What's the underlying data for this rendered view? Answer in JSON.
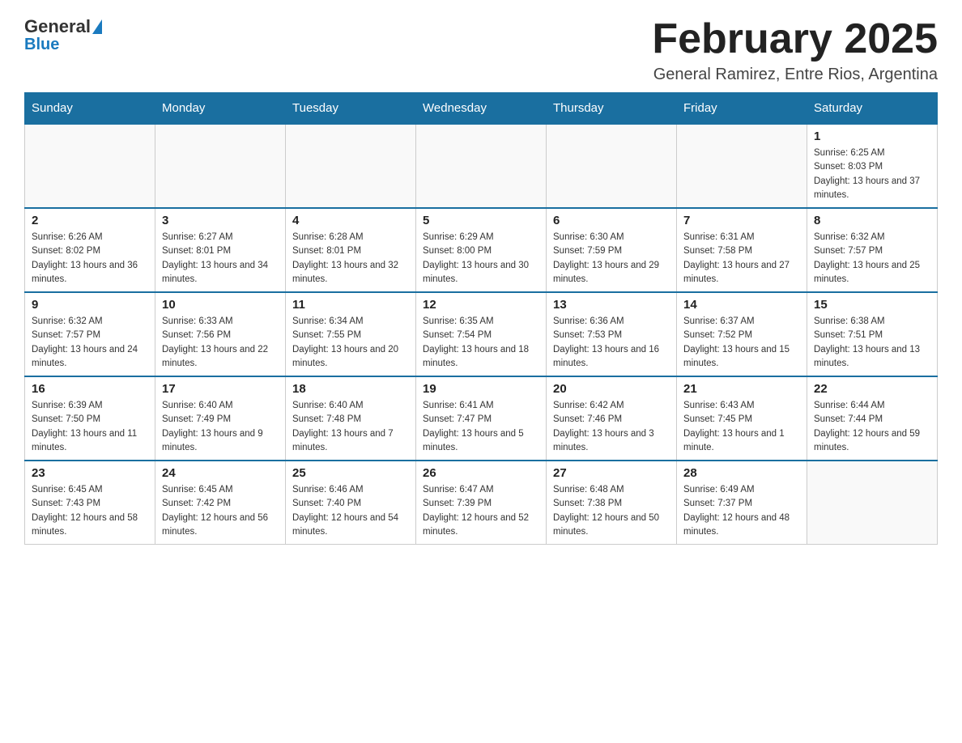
{
  "header": {
    "logo_general": "General",
    "logo_blue": "Blue",
    "month_title": "February 2025",
    "location": "General Ramirez, Entre Rios, Argentina"
  },
  "days_of_week": [
    "Sunday",
    "Monday",
    "Tuesday",
    "Wednesday",
    "Thursday",
    "Friday",
    "Saturday"
  ],
  "weeks": [
    [
      {
        "day": "",
        "info": ""
      },
      {
        "day": "",
        "info": ""
      },
      {
        "day": "",
        "info": ""
      },
      {
        "day": "",
        "info": ""
      },
      {
        "day": "",
        "info": ""
      },
      {
        "day": "",
        "info": ""
      },
      {
        "day": "1",
        "info": "Sunrise: 6:25 AM\nSunset: 8:03 PM\nDaylight: 13 hours and 37 minutes."
      }
    ],
    [
      {
        "day": "2",
        "info": "Sunrise: 6:26 AM\nSunset: 8:02 PM\nDaylight: 13 hours and 36 minutes."
      },
      {
        "day": "3",
        "info": "Sunrise: 6:27 AM\nSunset: 8:01 PM\nDaylight: 13 hours and 34 minutes."
      },
      {
        "day": "4",
        "info": "Sunrise: 6:28 AM\nSunset: 8:01 PM\nDaylight: 13 hours and 32 minutes."
      },
      {
        "day": "5",
        "info": "Sunrise: 6:29 AM\nSunset: 8:00 PM\nDaylight: 13 hours and 30 minutes."
      },
      {
        "day": "6",
        "info": "Sunrise: 6:30 AM\nSunset: 7:59 PM\nDaylight: 13 hours and 29 minutes."
      },
      {
        "day": "7",
        "info": "Sunrise: 6:31 AM\nSunset: 7:58 PM\nDaylight: 13 hours and 27 minutes."
      },
      {
        "day": "8",
        "info": "Sunrise: 6:32 AM\nSunset: 7:57 PM\nDaylight: 13 hours and 25 minutes."
      }
    ],
    [
      {
        "day": "9",
        "info": "Sunrise: 6:32 AM\nSunset: 7:57 PM\nDaylight: 13 hours and 24 minutes."
      },
      {
        "day": "10",
        "info": "Sunrise: 6:33 AM\nSunset: 7:56 PM\nDaylight: 13 hours and 22 minutes."
      },
      {
        "day": "11",
        "info": "Sunrise: 6:34 AM\nSunset: 7:55 PM\nDaylight: 13 hours and 20 minutes."
      },
      {
        "day": "12",
        "info": "Sunrise: 6:35 AM\nSunset: 7:54 PM\nDaylight: 13 hours and 18 minutes."
      },
      {
        "day": "13",
        "info": "Sunrise: 6:36 AM\nSunset: 7:53 PM\nDaylight: 13 hours and 16 minutes."
      },
      {
        "day": "14",
        "info": "Sunrise: 6:37 AM\nSunset: 7:52 PM\nDaylight: 13 hours and 15 minutes."
      },
      {
        "day": "15",
        "info": "Sunrise: 6:38 AM\nSunset: 7:51 PM\nDaylight: 13 hours and 13 minutes."
      }
    ],
    [
      {
        "day": "16",
        "info": "Sunrise: 6:39 AM\nSunset: 7:50 PM\nDaylight: 13 hours and 11 minutes."
      },
      {
        "day": "17",
        "info": "Sunrise: 6:40 AM\nSunset: 7:49 PM\nDaylight: 13 hours and 9 minutes."
      },
      {
        "day": "18",
        "info": "Sunrise: 6:40 AM\nSunset: 7:48 PM\nDaylight: 13 hours and 7 minutes."
      },
      {
        "day": "19",
        "info": "Sunrise: 6:41 AM\nSunset: 7:47 PM\nDaylight: 13 hours and 5 minutes."
      },
      {
        "day": "20",
        "info": "Sunrise: 6:42 AM\nSunset: 7:46 PM\nDaylight: 13 hours and 3 minutes."
      },
      {
        "day": "21",
        "info": "Sunrise: 6:43 AM\nSunset: 7:45 PM\nDaylight: 13 hours and 1 minute."
      },
      {
        "day": "22",
        "info": "Sunrise: 6:44 AM\nSunset: 7:44 PM\nDaylight: 12 hours and 59 minutes."
      }
    ],
    [
      {
        "day": "23",
        "info": "Sunrise: 6:45 AM\nSunset: 7:43 PM\nDaylight: 12 hours and 58 minutes."
      },
      {
        "day": "24",
        "info": "Sunrise: 6:45 AM\nSunset: 7:42 PM\nDaylight: 12 hours and 56 minutes."
      },
      {
        "day": "25",
        "info": "Sunrise: 6:46 AM\nSunset: 7:40 PM\nDaylight: 12 hours and 54 minutes."
      },
      {
        "day": "26",
        "info": "Sunrise: 6:47 AM\nSunset: 7:39 PM\nDaylight: 12 hours and 52 minutes."
      },
      {
        "day": "27",
        "info": "Sunrise: 6:48 AM\nSunset: 7:38 PM\nDaylight: 12 hours and 50 minutes."
      },
      {
        "day": "28",
        "info": "Sunrise: 6:49 AM\nSunset: 7:37 PM\nDaylight: 12 hours and 48 minutes."
      },
      {
        "day": "",
        "info": ""
      }
    ]
  ]
}
